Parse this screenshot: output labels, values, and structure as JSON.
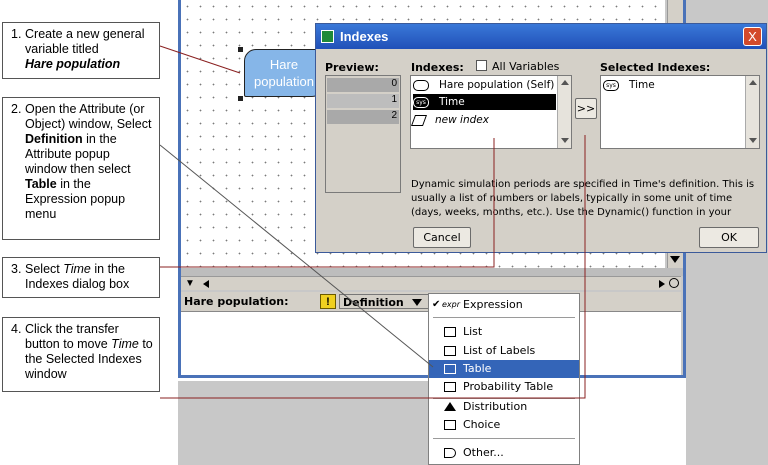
{
  "callouts": [
    {
      "num": "1.",
      "lines": [
        "Create a new general",
        "variable titled"
      ],
      "emph": "Hare population"
    },
    {
      "num": "2.",
      "parts": [
        "Open the Attribute (or Object) window, Select ",
        "Definition",
        " in the Attribute popup window then select ",
        "Table",
        " in the Expression popup menu"
      ]
    },
    {
      "num": "3.",
      "parts": [
        "Select ",
        "Time",
        " in the Indexes dialog box"
      ]
    },
    {
      "num": "4.",
      "parts": [
        "Click the transfer button to move ",
        "Time",
        " to the Selected Indexes window"
      ]
    }
  ],
  "node": {
    "label": "Hare population"
  },
  "dialog": {
    "title": "Indexes",
    "close": "X",
    "preview_label": "Preview:",
    "preview_rows": [
      "0",
      "1",
      "2"
    ],
    "indexes_label": "Indexes:",
    "all_variables": "All Variables",
    "index_items": [
      {
        "label": "Hare population (Self)",
        "icon": ""
      },
      {
        "label": "Time",
        "icon": "sys"
      },
      {
        "label": "new index",
        "icon": ""
      }
    ],
    "transfer": ">>",
    "selected_label": "Selected Indexes:",
    "selected_items": [
      {
        "label": "Time",
        "icon": "sys"
      }
    ],
    "description": "Dynamic simulation periods are specified in Time's definition. This is usually a list of numbers or labels, typically in some unit of time (days, weeks, months, etc.).  Use the Dynamic() function in your variables to perform dynamic",
    "cancel": "Cancel",
    "ok": "OK"
  },
  "attr": {
    "label": "Hare population:",
    "popup": "Definition"
  },
  "menu": {
    "items": [
      {
        "label": "Expression",
        "icon": "expr",
        "check": "✔"
      },
      {
        "label": "List",
        "icon": "list"
      },
      {
        "label": "List of Labels",
        "icon": "list"
      },
      {
        "label": "Table",
        "icon": "table"
      },
      {
        "label": "Probability Table",
        "icon": "table"
      },
      {
        "label": "Distribution",
        "icon": "triangle"
      },
      {
        "label": "Choice",
        "icon": "choice"
      },
      {
        "label": "Other...",
        "icon": "other"
      }
    ]
  }
}
